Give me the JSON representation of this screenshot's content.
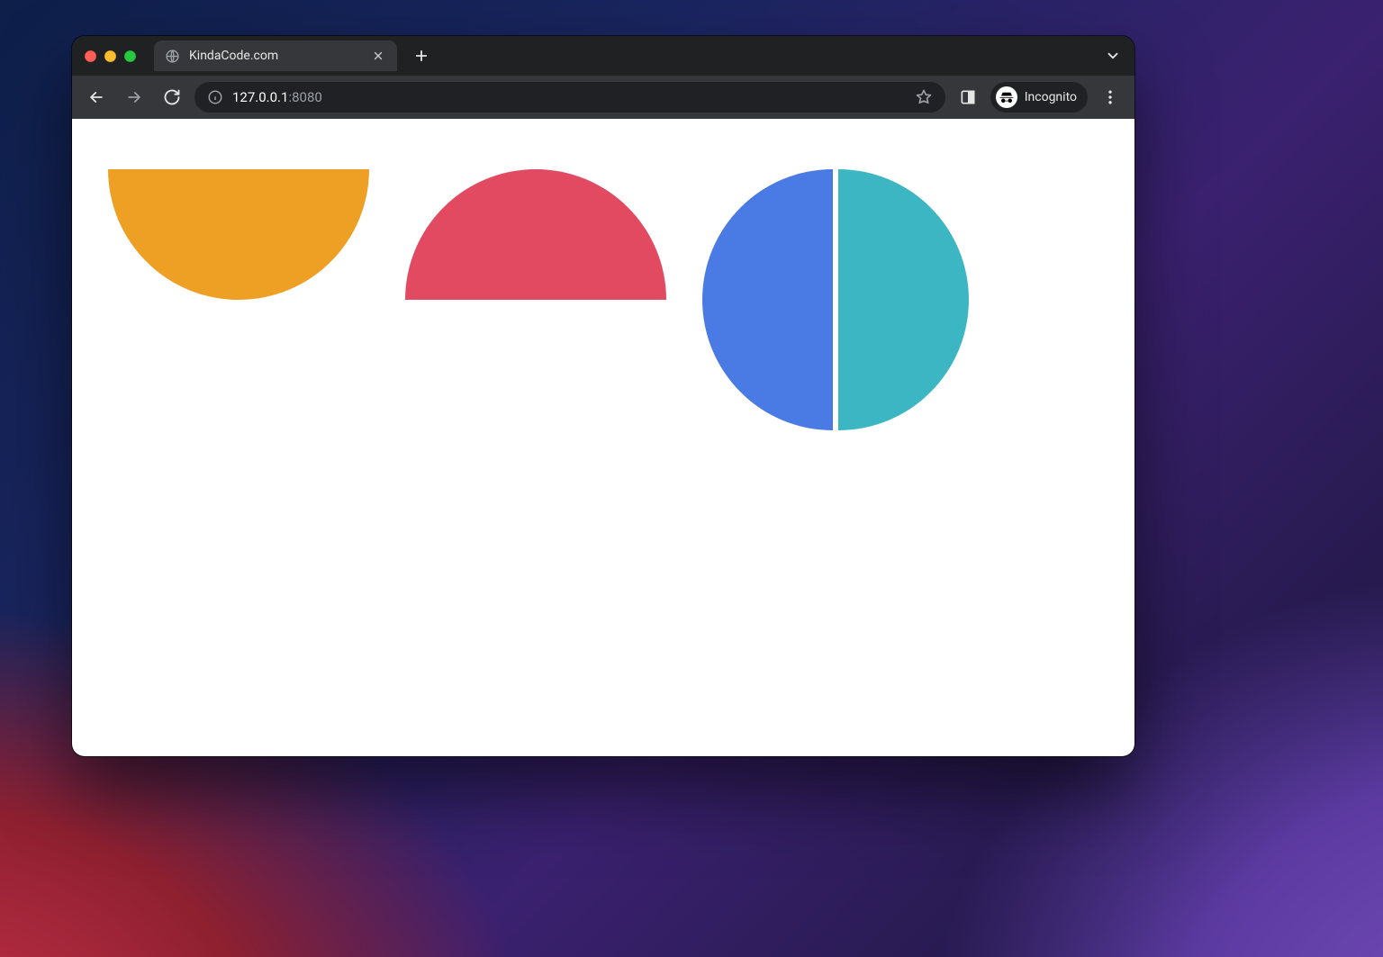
{
  "browser": {
    "tab_title": "KindaCode.com",
    "address_host": "127.0.0.1",
    "address_port": ":8080",
    "incognito_label": "Incognito"
  },
  "shapes": {
    "orange": "#eea024",
    "red": "#e14a61",
    "blue": "#4a7ae4",
    "teal": "#3db6c4"
  }
}
